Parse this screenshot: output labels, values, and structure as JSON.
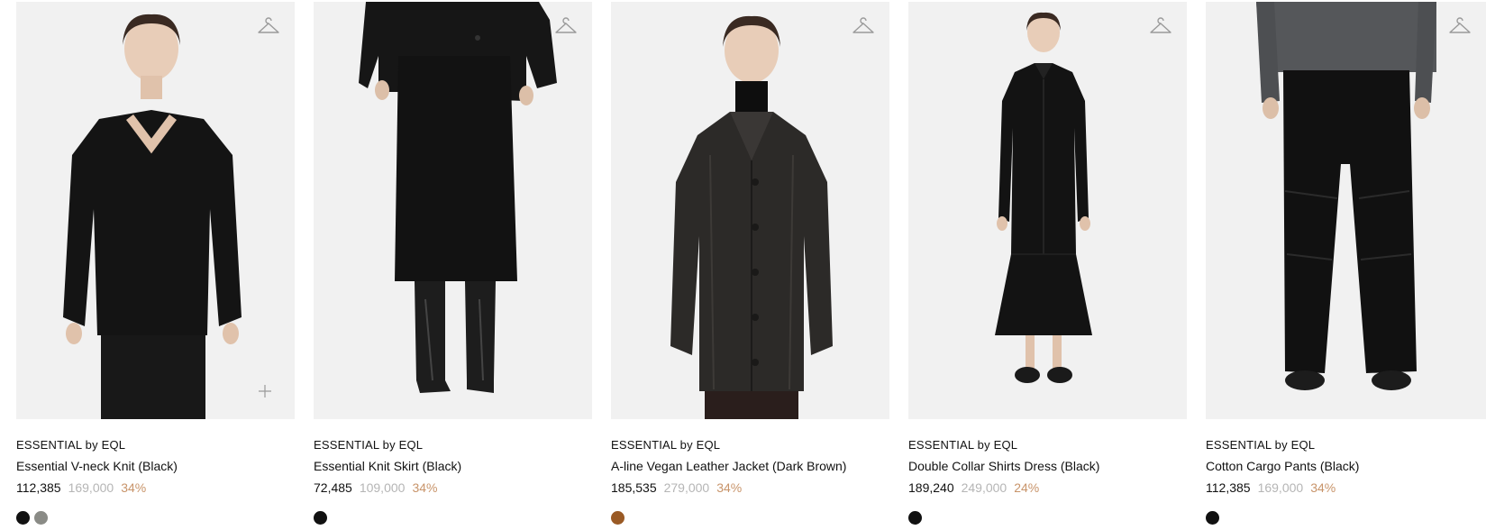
{
  "products": [
    {
      "brand": "ESSENTIAL by EQL",
      "name": "Essential V-neck Knit (Black)",
      "sale_price": "112,385",
      "original_price": "169,000",
      "discount": "34%",
      "swatches": [
        "#111111",
        "#8a8b86"
      ],
      "icons": [
        "hanger-icon",
        "plus-icon"
      ]
    },
    {
      "brand": "ESSENTIAL by EQL",
      "name": "Essential Knit Skirt (Black)",
      "sale_price": "72,485",
      "original_price": "109,000",
      "discount": "34%",
      "swatches": [
        "#111111"
      ],
      "icons": [
        "hanger-icon"
      ]
    },
    {
      "brand": "ESSENTIAL by EQL",
      "name": "A-line Vegan Leather Jacket (Dark Brown)",
      "sale_price": "185,535",
      "original_price": "279,000",
      "discount": "34%",
      "swatches": [
        "#9a5a25"
      ],
      "icons": [
        "hanger-icon"
      ]
    },
    {
      "brand": "ESSENTIAL by EQL",
      "name": "Double Collar Shirts Dress (Black)",
      "sale_price": "189,240",
      "original_price": "249,000",
      "discount": "24%",
      "swatches": [
        "#111111"
      ],
      "icons": [
        "hanger-icon"
      ]
    },
    {
      "brand": "ESSENTIAL by EQL",
      "name": "Cotton Cargo Pants (Black)",
      "sale_price": "112,385",
      "original_price": "169,000",
      "discount": "34%",
      "swatches": [
        "#111111"
      ],
      "icons": [
        "hanger-icon"
      ]
    }
  ],
  "colors": {
    "image_bg": "#f1f1f1",
    "text": "#111111",
    "original_price": "#b5b5b5",
    "discount": "#c8946a"
  }
}
